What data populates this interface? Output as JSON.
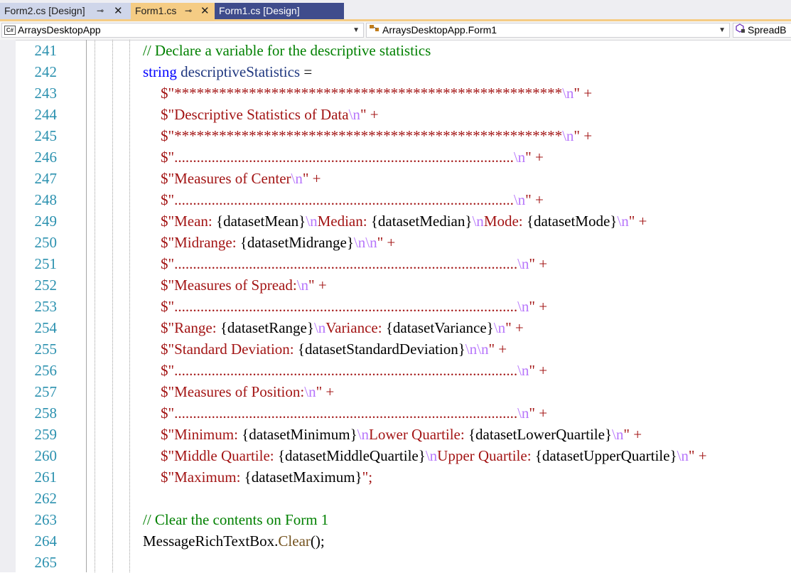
{
  "tabs": [
    {
      "label": "Form2.cs [Design]",
      "pin": "⊸",
      "close": "✕"
    },
    {
      "label": "Form1.cs",
      "pin": "⊸",
      "close": "✕"
    },
    {
      "label": "Form1.cs [Design]"
    }
  ],
  "nav": {
    "project": "ArraysDesktopApp",
    "type": "ArraysDesktopApp.Form1",
    "member": "SpreadB"
  },
  "colors": {
    "active_tab": "#f5cc84",
    "preview_tab": "#3f4c8c",
    "line_numbers": "#2b91af",
    "comment": "#008000",
    "keyword": "#0000ff",
    "string": "#a31515",
    "escape": "#b776fb"
  },
  "line_numbers": [
    "241",
    "242",
    "243",
    "244",
    "245",
    "246",
    "247",
    "248",
    "249",
    "250",
    "251",
    "252",
    "253",
    "254",
    "255",
    "256",
    "257",
    "258",
    "259",
    "260",
    "261",
    "262",
    "263",
    "264",
    "265"
  ],
  "code": {
    "l241": {
      "comment": "// Declare a variable for the descriptive statistics"
    },
    "l242": {
      "kw": "string",
      "var": "descriptiveStatistics",
      "op": " ="
    },
    "l243": {
      "s": "$\"****************************************************",
      "e": "\\n",
      "end": "\" +"
    },
    "l244": {
      "s": "$\"Descriptive Statistics of Data",
      "e": "\\n",
      "end": "\" +"
    },
    "l245": {
      "s": "$\"****************************************************",
      "e": "\\n",
      "end": "\" +"
    },
    "l246": {
      "s": "$\"...........................................................................................",
      "e": "\\n",
      "end": "\" +"
    },
    "l247": {
      "s": "$\"Measures of Center",
      "e": "\\n",
      "end": "\" +"
    },
    "l248": {
      "s": "$\"...........................................................................................",
      "e": "\\n",
      "end": "\" +"
    },
    "l249": {
      "s1": "$\"Mean: ",
      "v1": "{datasetMean}",
      "e1": "\\n",
      "s2": "Median: ",
      "v2": "{datasetMedian}",
      "e2": "\\n",
      "s3": "Mode: ",
      "v3": "{datasetMode}",
      "e3": "\\n",
      "end": "\" +"
    },
    "l250": {
      "s1": "$\"Midrange: ",
      "v1": "{datasetMidrange}",
      "e1": "\\n\\n",
      "end": "\" +"
    },
    "l251": {
      "s": "$\"............................................................................................",
      "e": "\\n",
      "end": "\" +"
    },
    "l252": {
      "s": "$\"Measures of Spread:",
      "e": "\\n",
      "end": "\" +"
    },
    "l253": {
      "s": "$\"............................................................................................",
      "e": "\\n",
      "end": "\" +"
    },
    "l254": {
      "s1": "$\"Range: ",
      "v1": "{datasetRange}",
      "e1": "\\n",
      "s2": "Variance: ",
      "v2": "{datasetVariance}",
      "e2": "\\n",
      "end": "\" +"
    },
    "l255": {
      "s1": "$\"Standard Deviation: ",
      "v1": "{datasetStandardDeviation}",
      "e1": "\\n\\n",
      "end": "\" +"
    },
    "l256": {
      "s": "$\"............................................................................................",
      "e": "\\n",
      "end": "\" +"
    },
    "l257": {
      "s": "$\"Measures of Position:",
      "e": "\\n",
      "end": "\" +"
    },
    "l258": {
      "s": "$\"............................................................................................",
      "e": "\\n",
      "end": "\" +"
    },
    "l259": {
      "s1": "$\"Minimum: ",
      "v1": "{datasetMinimum}",
      "e1": "\\n",
      "s2": "Lower Quartile: ",
      "v2": "{datasetLowerQuartile}",
      "e2": "\\n",
      "end": "\" +"
    },
    "l260": {
      "s1": "$\"Middle Quartile: ",
      "v1": "{datasetMiddleQuartile}",
      "e1": "\\n",
      "s2": "Upper Quartile: ",
      "v2": "{datasetUpperQuartile}",
      "e2": "\\n",
      "end": "\" +"
    },
    "l261": {
      "s1": "$\"Maximum: ",
      "v1": "{datasetMaximum}",
      "end": "\";"
    },
    "l263": {
      "comment": "// Clear the contents on Form 1"
    },
    "l264": {
      "obj": "MessageRichTextBox.",
      "method": "Clear",
      "end": "();"
    }
  }
}
